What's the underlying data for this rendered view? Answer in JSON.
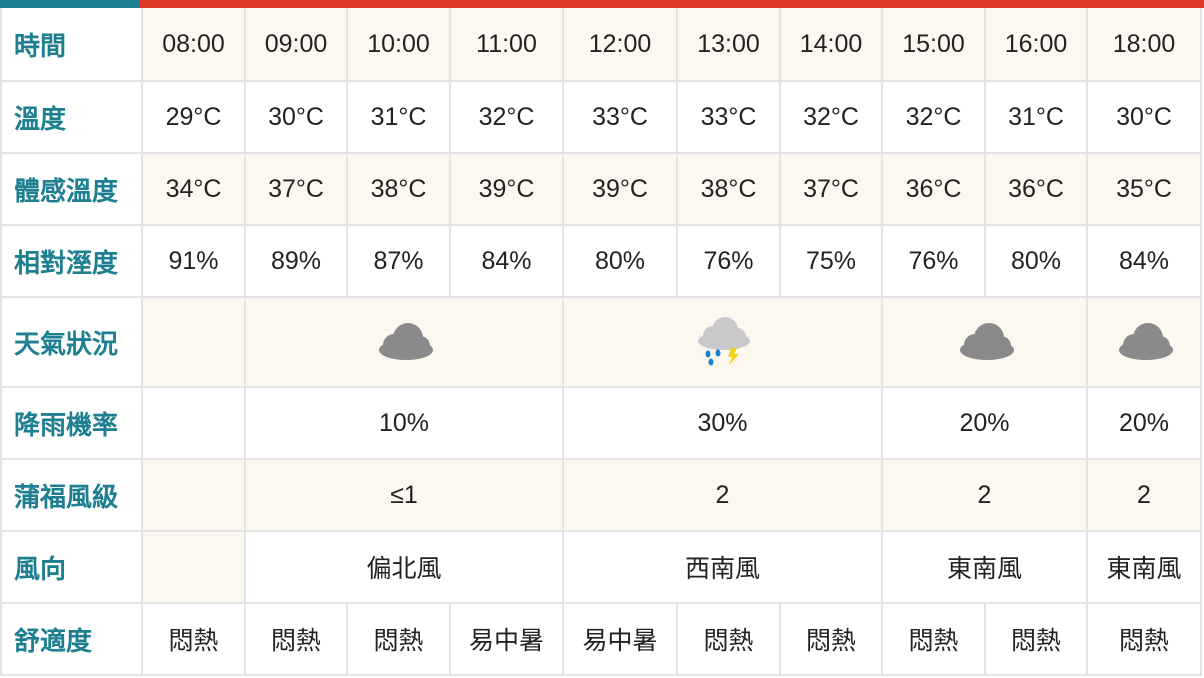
{
  "colors": {
    "accent_teal": "#1d7f8f",
    "accent_red": "#e0392a",
    "time_day": "#cf4a12",
    "cream_bg": "#fdf8ef",
    "grid": "#e3e3e3"
  },
  "row_labels": {
    "time": "時間",
    "temp": "溫度",
    "feel": "體感溫度",
    "humidity": "相對溼度",
    "weather": "天氣狀況",
    "rain": "降雨機率",
    "beaufort": "蒲福風級",
    "wind_dir": "風向",
    "comfort": "舒適度"
  },
  "times": [
    "08:00",
    "09:00",
    "10:00",
    "11:00",
    "12:00",
    "13:00",
    "14:00",
    "15:00",
    "16:00",
    "18:00"
  ],
  "temps": [
    "29°C",
    "30°C",
    "31°C",
    "32°C",
    "33°C",
    "33°C",
    "32°C",
    "32°C",
    "31°C",
    "30°C"
  ],
  "feels": [
    "34°C",
    "37°C",
    "38°C",
    "39°C",
    "39°C",
    "38°C",
    "37°C",
    "36°C",
    "36°C",
    "35°C"
  ],
  "humidity": [
    "91%",
    "89%",
    "87%",
    "84%",
    "80%",
    "76%",
    "75%",
    "76%",
    "80%",
    "84%"
  ],
  "weather_icons": [
    "cloudy-icon",
    "thunder-shower-icon",
    "cloudy-icon",
    "cloudy-icon"
  ],
  "rain": [
    "10%",
    "30%",
    "20%",
    "20%"
  ],
  "beaufort": [
    "≤1",
    "2",
    "2",
    "2"
  ],
  "wind_dir": [
    "偏北風",
    "西南風",
    "東南風",
    "東南風"
  ],
  "comfort": [
    "悶熱",
    "悶熱",
    "悶熱",
    "易中暑",
    "易中暑",
    "悶熱",
    "悶熱",
    "悶熱",
    "悶熱",
    "悶熱"
  ]
}
